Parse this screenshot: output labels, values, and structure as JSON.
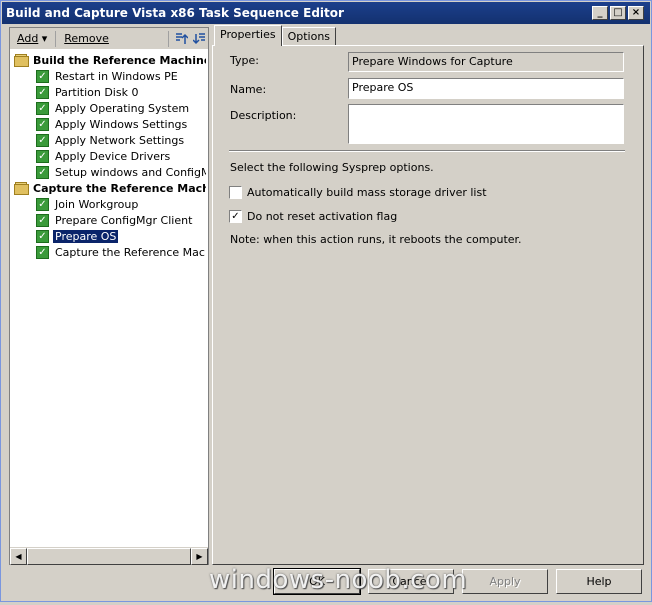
{
  "window": {
    "title": "Build and Capture Vista x86 Task Sequence Editor"
  },
  "titlebar_buttons": {
    "minimize": "_",
    "maximize": "□",
    "close": "×"
  },
  "toolbar": {
    "add_label": "Add",
    "add_dropdown_glyph": "▾",
    "remove_label": "Remove",
    "move_up_icon": "move-up-icon",
    "move_down_icon": "move-down-icon"
  },
  "tree": {
    "groups": [
      {
        "label": "Build the Reference Machine",
        "steps": [
          "Restart in Windows PE",
          "Partition Disk 0",
          "Apply Operating System",
          "Apply Windows Settings",
          "Apply Network Settings",
          "Apply Device Drivers",
          "Setup windows and ConfigMgr"
        ]
      },
      {
        "label": "Capture the Reference Machine",
        "steps": [
          "Join Workgroup",
          "Prepare ConfigMgr Client",
          "Prepare OS",
          "Capture the Reference Machine"
        ]
      }
    ],
    "selected": "Prepare OS"
  },
  "tabs": [
    {
      "label": "Properties",
      "active": true
    },
    {
      "label": "Options",
      "active": false
    }
  ],
  "properties": {
    "type_label": "Type:",
    "type_value": "Prepare Windows for Capture",
    "name_label": "Name:",
    "name_value": "Prepare OS",
    "description_label": "Description:",
    "description_value": "",
    "sysprep_intro": "Select the following Sysprep options.",
    "option_mass_storage": "Automatically build mass storage driver list",
    "option_mass_storage_checked": false,
    "option_no_reset": "Do not reset activation flag",
    "option_no_reset_checked": true,
    "note": "Note: when this action runs, it reboots the computer."
  },
  "buttons": {
    "ok": "OK",
    "cancel": "Cancel",
    "apply": "Apply",
    "help": "Help"
  },
  "watermark": "windows-noob.com",
  "colors": {
    "title_bar": "#13316f",
    "selection": "#0a246a",
    "step_check": "#3a9a3a",
    "dialog_face": "#d4d0c8"
  }
}
